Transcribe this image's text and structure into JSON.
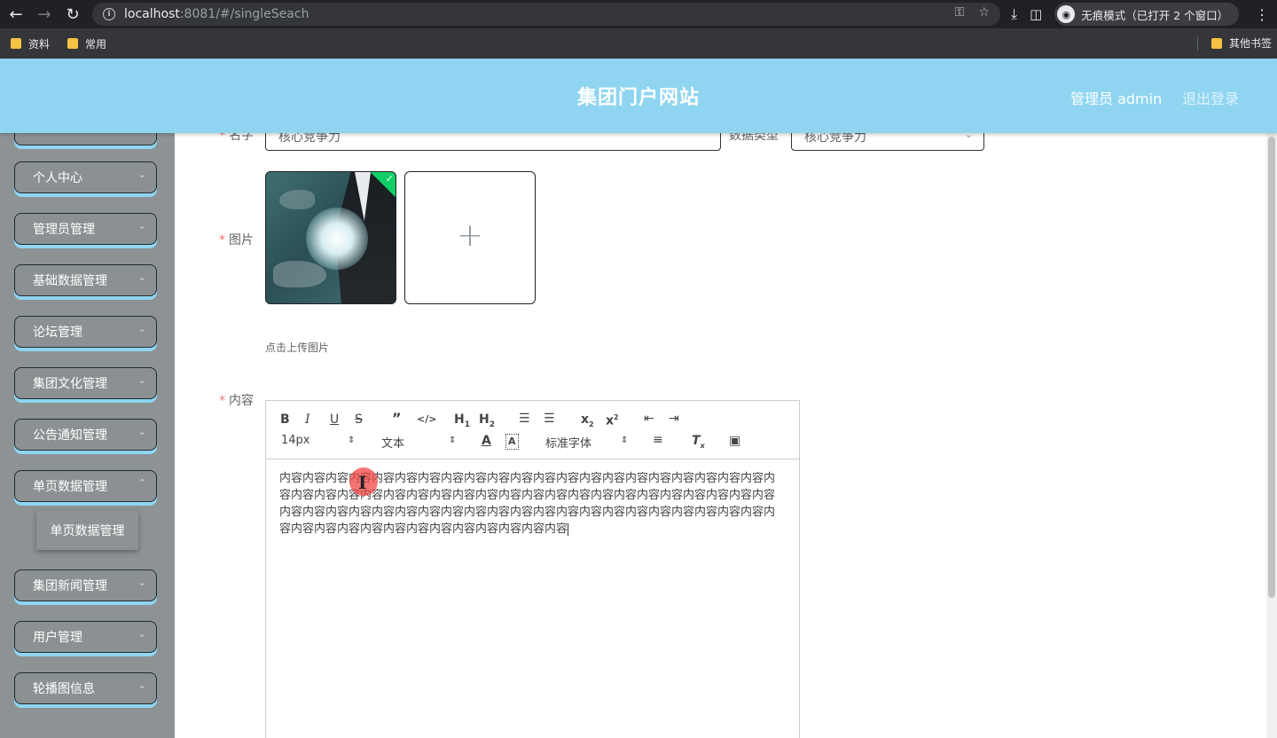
{
  "browser": {
    "url_host": "localhost",
    "url_rest": ":8081/#/singleSeach",
    "incognito_text": "无痕模式（已打开 2 个窗口）",
    "bookmarks": [
      "资料",
      "常用"
    ],
    "bookmarks_right": "其他书签"
  },
  "header": {
    "title": "集团门户网站",
    "admin": "管理员 admin",
    "logout": "退出登录"
  },
  "sidebar": {
    "items": [
      {
        "label": "个人中心"
      },
      {
        "label": "管理员管理"
      },
      {
        "label": "基础数据管理"
      },
      {
        "label": "论坛管理"
      },
      {
        "label": "集团文化管理"
      },
      {
        "label": "公告通知管理"
      },
      {
        "label": "单页数据管理"
      },
      {
        "label": "集团新闻管理"
      },
      {
        "label": "用户管理"
      },
      {
        "label": "轮播图信息"
      }
    ],
    "submenu_label": "单页数据管理"
  },
  "form": {
    "name_label": "名字",
    "name_value": "核心竞争力",
    "type_label": "数据类型",
    "type_value": "核心竞争力",
    "image_label": "图片",
    "upload_hint": "点击上传图片",
    "content_label": "内容",
    "required_mark": "*"
  },
  "editor": {
    "font_size": "14px",
    "format": "文本",
    "font_family": "标准字体",
    "content": "内容内容内容内容内容内容内容内容内容内容内容内容内容内容内容内容内容内容内容内容内容内容内容内容内容内容内容内容内容内容内容内容内容内容内容内容内容内容内容内容内容内容内容内容内容内容内容内容内容内容内容内容内容内容内容内容内容内容内容内容内容内容内容内容内容内容内容内容内容内容内容内容内容内容内容内容内容"
  }
}
